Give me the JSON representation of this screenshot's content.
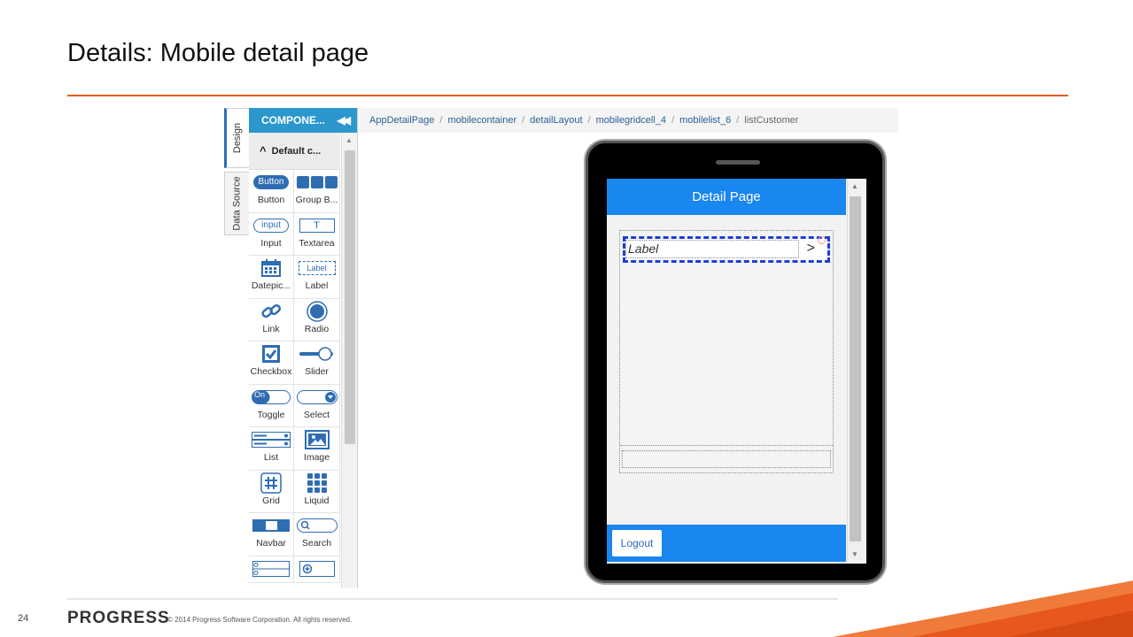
{
  "slide": {
    "title": "Details: Mobile detail page",
    "page_number": "24",
    "brand": "PROGRESS",
    "copyright": "© 2014 Progress Software Corporation. All rights reserved."
  },
  "colors": {
    "accent": "#e8581e",
    "palette_header": "#2b97cc",
    "app_blue": "#1a86f0",
    "icon_blue": "#2f6db3"
  },
  "side_tabs": {
    "design": "Design",
    "data_source": "Data Source"
  },
  "palette": {
    "header": "COMPONE...",
    "group": "Default c...",
    "items": [
      {
        "icon_text": "Button",
        "label": "Button"
      },
      {
        "icon_text": "",
        "label": "Group B..."
      },
      {
        "icon_text": "input",
        "label": "Input"
      },
      {
        "icon_text": "T",
        "label": "Textarea"
      },
      {
        "icon_text": "",
        "label": "Datepic..."
      },
      {
        "icon_text": "Label",
        "label": "Label"
      },
      {
        "icon_text": "",
        "label": "Link"
      },
      {
        "icon_text": "",
        "label": "Radio"
      },
      {
        "icon_text": "",
        "label": "Checkbox"
      },
      {
        "icon_text": "",
        "label": "Slider"
      },
      {
        "icon_text": "On",
        "label": "Toggle"
      },
      {
        "icon_text": "",
        "label": "Select"
      },
      {
        "icon_text": "",
        "label": "List"
      },
      {
        "icon_text": "",
        "label": "Image"
      },
      {
        "icon_text": "",
        "label": "Grid"
      },
      {
        "icon_text": "",
        "label": "Liquid"
      },
      {
        "icon_text": "",
        "label": "Navbar"
      },
      {
        "icon_text": "",
        "label": "Search"
      }
    ]
  },
  "breadcrumb": [
    "AppDetailPage",
    "mobilecontainer",
    "detailLayout",
    "mobilegridcell_4",
    "mobilelist_6",
    "listCustomer"
  ],
  "device": {
    "header_title": "Detail Page",
    "list_item_label": "Label",
    "list_item_arrow": ">",
    "logout_button": "Logout"
  }
}
